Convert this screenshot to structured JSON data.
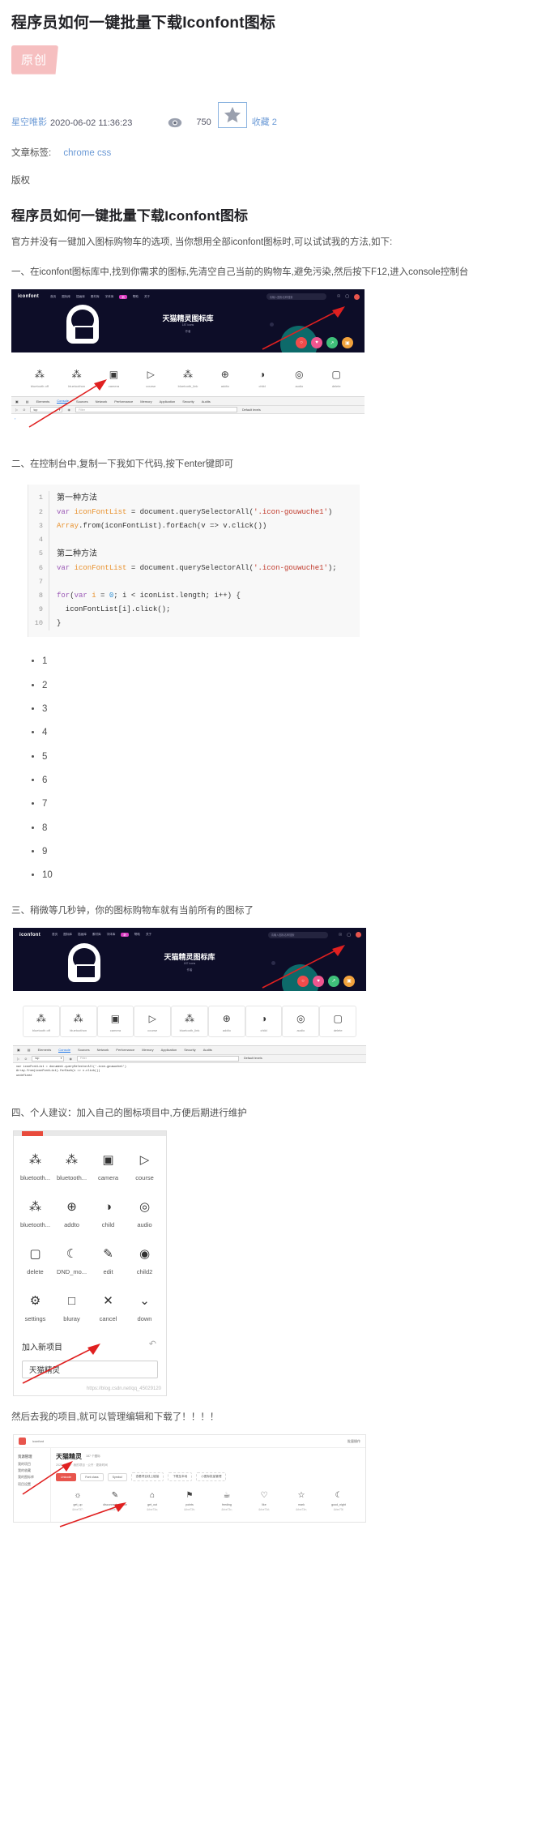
{
  "header": {
    "post_title": "程序员如何一键批量下载Iconfont图标",
    "original_badge": "原创",
    "author": "星空唯影",
    "date": "2020-06-02 11:36:23",
    "eye_icon": "eye-icon",
    "view_count": "750",
    "star_icon": "star-icon",
    "favorite_label": "收藏 2",
    "tags_label": "文章标签:",
    "tags_link": "chrome css",
    "copyright": "版权"
  },
  "article": {
    "heading": "程序员如何一键批量下载Iconfont图标",
    "intro": "官方并没有一键加入图标购物车的选项, 当你想用全部iconfont图标时,可以试试我的方法,如下:",
    "step1": "一、在iconfont图标库中,找到你需求的图标,先清空自己当前的购物车,避免污染,然后按下F12,进入console控制台",
    "step2": "二、在控制台中,复制一下我如下代码,按下enter键即可",
    "step3": "三、稍微等几秒钟，你的图标购物车就有当前所有的图标了",
    "step4": "四、个人建议：加入自己的图标项目中,方便后期进行维护",
    "step5": "然后去我的项目,就可以管理编辑和下载了！！！！"
  },
  "code": {
    "lines": [
      {
        "n": "1",
        "text": "第一种方法",
        "type": "cn"
      },
      {
        "n": "2",
        "text": "var iconFontList = document.querySelectorAll('.icon-gouwuche1')",
        "type": "js"
      },
      {
        "n": "3",
        "text": "Array.from(iconFontList).forEach(v => v.click())",
        "type": "js"
      },
      {
        "n": "4",
        "text": "",
        "type": "blank"
      },
      {
        "n": "5",
        "text": "第二种方法",
        "type": "cn"
      },
      {
        "n": "6",
        "text": "var iconFontList = document.querySelectorAll('.icon-gouwuche1');",
        "type": "js"
      },
      {
        "n": "7",
        "text": "",
        "type": "blank"
      },
      {
        "n": "8",
        "text": "for(var i = 0; i < iconList.length; i++) {",
        "type": "js"
      },
      {
        "n": "9",
        "text": "  iconFontList[i].click();",
        "type": "js"
      },
      {
        "n": "10",
        "text": "}",
        "type": "js"
      }
    ]
  },
  "numbered_list": [
    "1",
    "2",
    "3",
    "4",
    "5",
    "6",
    "7",
    "8",
    "9",
    "10"
  ],
  "iconfont_shot": {
    "logo": "iconfont",
    "nav": [
      "首页",
      "图标库",
      "插画库",
      "素材库",
      "字体库",
      "帮助",
      "关于"
    ],
    "nav_pill": "新",
    "search_placeholder": "请输入图标名称搜索",
    "hero_title": "天猫精灵图标库",
    "hero_sub": "187 icons",
    "hero_sub2": "作者",
    "fabs": [
      "search-icon",
      "heart-icon",
      "share-icon",
      "cart-icon"
    ],
    "icons": [
      {
        "glyph": "bluetooth-off-icon",
        "label": "bluetooth off"
      },
      {
        "glyph": "bluetooth-icon",
        "label": "bluetoothon"
      },
      {
        "glyph": "camera-icon",
        "label": "camera"
      },
      {
        "glyph": "course-icon",
        "label": "course"
      },
      {
        "glyph": "bluetooth-link-icon",
        "label": "bluetooth_link"
      },
      {
        "glyph": "addto-icon",
        "label": "addto"
      },
      {
        "glyph": "child-icon",
        "label": "child"
      },
      {
        "glyph": "audio-icon",
        "label": "audio"
      },
      {
        "glyph": "delete-icon",
        "label": "delete"
      }
    ]
  },
  "devtools": {
    "tabs": [
      "Elements",
      "Console",
      "Sources",
      "Network",
      "Performance",
      "Memory",
      "Application",
      "Security",
      "Audits"
    ],
    "active_tab": "Console",
    "context": "top",
    "filter_placeholder": "Filter",
    "levels": "Default levels",
    "echo_line1": "var iconFontList = document.querySelectorAll('.icon-gouwuche1')",
    "echo_line2": "Array.from(iconFontList).forEach(v => v.click())",
    "echo_line3": "undefined"
  },
  "panel_shot": {
    "add_label": "加入新项目",
    "undo_icon": "undo-icon",
    "input_value": "天猫精灵",
    "watermark": "https://blog.csdn.net/qq_45029120",
    "icons": [
      {
        "glyph": "bluetooth-off-icon",
        "label": "bluetooth..."
      },
      {
        "glyph": "bluetooth-icon",
        "label": "bluetooth..."
      },
      {
        "glyph": "camera-icon",
        "label": "camera"
      },
      {
        "glyph": "course-icon",
        "label": "course"
      },
      {
        "glyph": "bluetooth-link-icon",
        "label": "bluetooth..."
      },
      {
        "glyph": "addto-icon",
        "label": "addto"
      },
      {
        "glyph": "child-icon",
        "label": "child"
      },
      {
        "glyph": "audio-icon",
        "label": "audio"
      },
      {
        "glyph": "delete-icon",
        "label": "delete"
      },
      {
        "glyph": "dnd-moon-icon",
        "label": "DND_mo..."
      },
      {
        "glyph": "edit-icon",
        "label": "edit"
      },
      {
        "glyph": "child2-icon",
        "label": "child2"
      },
      {
        "glyph": "settings-icon",
        "label": "settings"
      },
      {
        "glyph": "bluray-icon",
        "label": "bluray"
      },
      {
        "glyph": "cancel-icon",
        "label": "cancel"
      },
      {
        "glyph": "down-icon",
        "label": "down"
      }
    ]
  },
  "bottom_shot": {
    "brand": "iconfont",
    "project_title": "天猫精灵",
    "project_tag": "187 个图标",
    "sub": "2020-06-02 · 我的项目 · 公开 · 更新时间",
    "badge": "Unicode",
    "badge2": "Font class",
    "badge3": "Symbol",
    "buttons": [
      "查看项目线上链接",
      "下载至本地",
      "小图标批量管理"
    ],
    "side_items": [
      "我的项目",
      "我的收藏",
      "我的图标库",
      "项目设置"
    ],
    "side_title": "资源管理",
    "right_label": "批量操作",
    "icons": [
      {
        "glyph": "get-up-icon",
        "label": "get_up",
        "uni": "&#xe737;"
      },
      {
        "glyph": "disconnect-icon",
        "label": "disconnect_device",
        "uni": "&#xe738;"
      },
      {
        "glyph": "get-out-icon",
        "label": "get_out",
        "uni": "&#xe73a;"
      },
      {
        "glyph": "points-icon",
        "label": "points",
        "uni": "&#xe73b;"
      },
      {
        "glyph": "feeding-icon",
        "label": "feeding",
        "uni": "&#xe73c;"
      },
      {
        "glyph": "like-icon",
        "label": "like",
        "uni": "&#xe73d;"
      },
      {
        "glyph": "mark-icon",
        "label": "mark",
        "uni": "&#xe73e;"
      },
      {
        "glyph": "good-night-icon",
        "label": "good_night",
        "uni": "&#xe73f;"
      }
    ]
  },
  "colors": {
    "accent_pink": "#f6bfc0",
    "link_blue": "#6b9ad6",
    "dark_hero": "#0d0d28",
    "red_arrow": "#e02020",
    "code_bg": "#f8f8f8"
  }
}
